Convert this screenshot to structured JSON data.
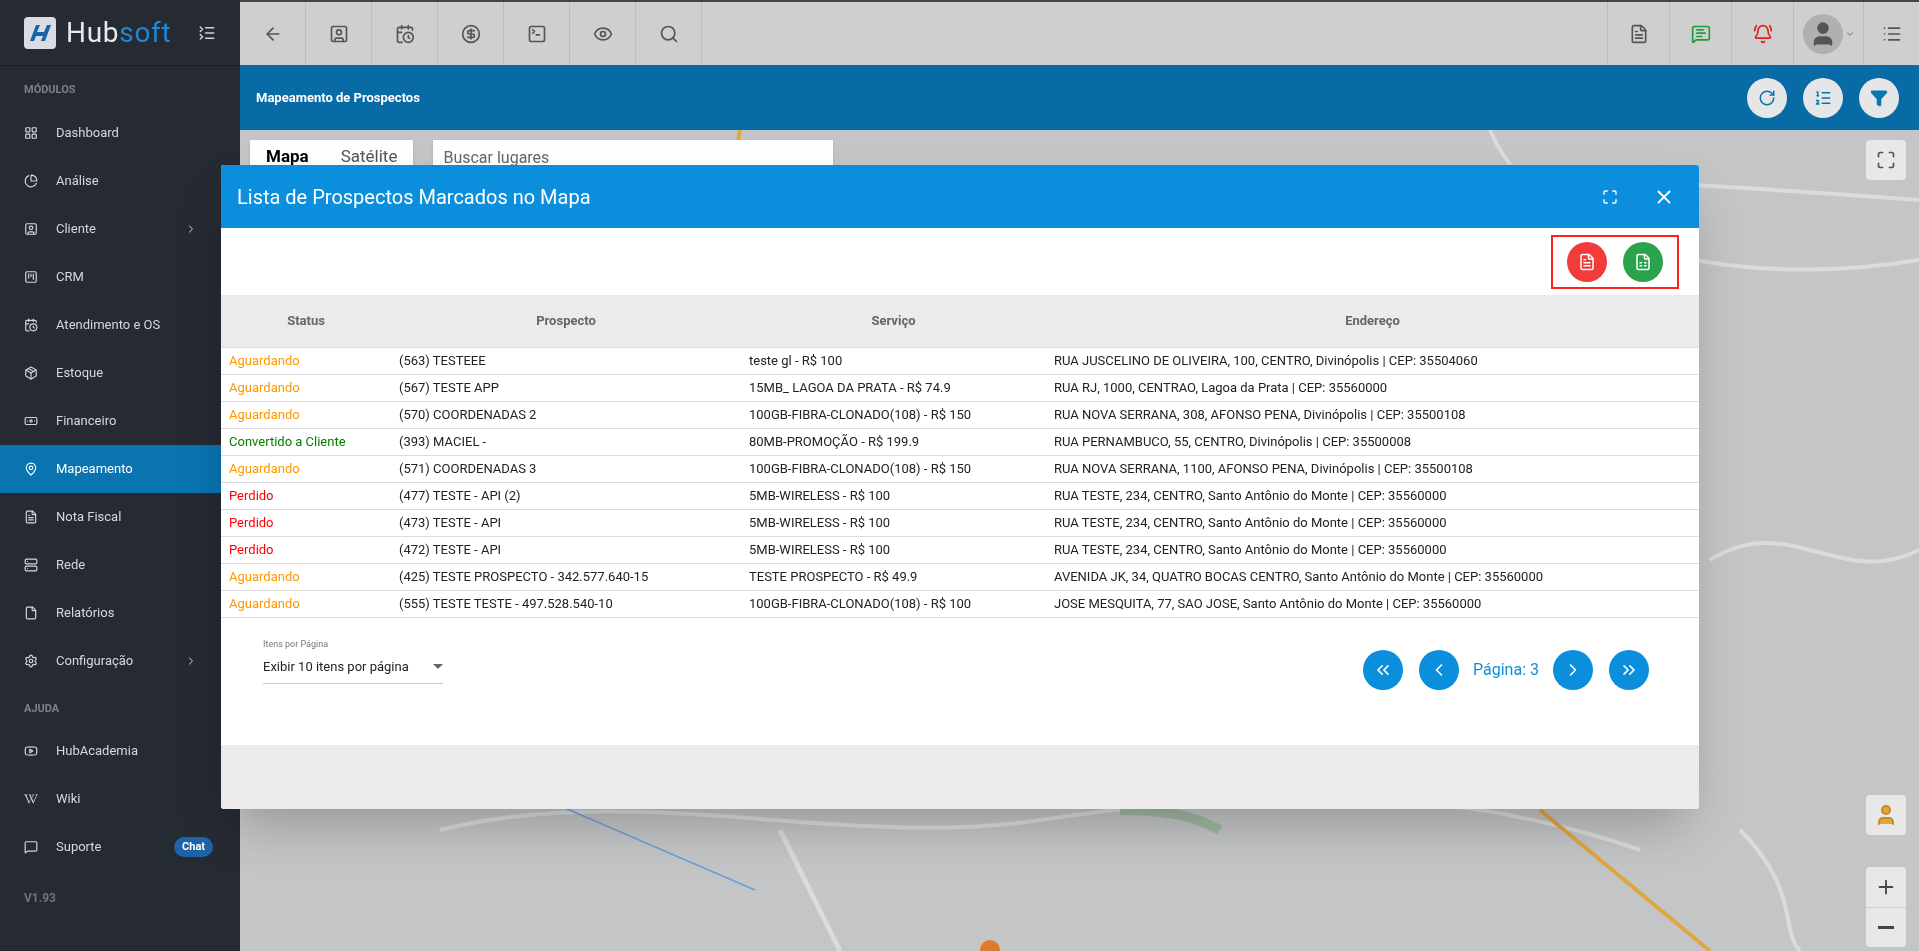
{
  "app": {
    "logo_parts": [
      "Hub",
      "soft"
    ],
    "version": "V1.93"
  },
  "sidebar": {
    "sections": [
      {
        "title": "MÓDULOS",
        "items": [
          {
            "label": "Dashboard",
            "selected": false,
            "has_submenu": false
          },
          {
            "label": "Análise",
            "selected": false,
            "has_submenu": false
          },
          {
            "label": "Cliente",
            "selected": false,
            "has_submenu": true
          },
          {
            "label": "CRM",
            "selected": false,
            "has_submenu": false
          },
          {
            "label": "Atendimento e OS",
            "selected": false,
            "has_submenu": false
          },
          {
            "label": "Estoque",
            "selected": false,
            "has_submenu": false
          },
          {
            "label": "Financeiro",
            "selected": false,
            "has_submenu": false
          },
          {
            "label": "Mapeamento",
            "selected": true,
            "has_submenu": false
          },
          {
            "label": "Nota Fiscal",
            "selected": false,
            "has_submenu": false
          },
          {
            "label": "Rede",
            "selected": false,
            "has_submenu": false
          },
          {
            "label": "Relatórios",
            "selected": false,
            "has_submenu": false
          },
          {
            "label": "Configuração",
            "selected": false,
            "has_submenu": true
          }
        ]
      },
      {
        "title": "AJUDA",
        "items": [
          {
            "label": "HubAcademia",
            "selected": false,
            "has_submenu": false
          },
          {
            "label": "Wiki",
            "selected": false,
            "has_submenu": false
          },
          {
            "label": "Suporte",
            "selected": false,
            "has_submenu": false,
            "badge": "Chat"
          }
        ]
      }
    ]
  },
  "page_header": {
    "title": "Mapeamento de Prospectos"
  },
  "map": {
    "tabs": [
      {
        "label": "Mapa",
        "selected": true
      },
      {
        "label": "Satélite",
        "selected": false
      }
    ],
    "search": {
      "placeholder": "Buscar lugares"
    }
  },
  "modal": {
    "title": "Lista de Prospectos Marcados no Mapa",
    "columns": [
      "Status",
      "Prospecto",
      "Serviço",
      "Endereço"
    ],
    "rows": [
      {
        "status": "Aguardando",
        "color": "#ff9800",
        "prospect": "(563) TESTEEE",
        "service": "teste gl - R$ 100",
        "address": "RUA JUSCELINO DE OLIVEIRA, 100, CENTRO, Divinópolis | CEP: 35504060"
      },
      {
        "status": "Aguardando",
        "color": "#ff9800",
        "prospect": "(567) TESTE APP",
        "service": "15MB_ LAGOA DA PRATA - R$ 74.9",
        "address": "RUA RJ, 1000, CENTRAO, Lagoa da Prata | CEP: 35560000"
      },
      {
        "status": "Aguardando",
        "color": "#ff9800",
        "prospect": "(570) COORDENADAS 2",
        "service": "100GB-FIBRA-CLONADO(108) - R$ 150",
        "address": "RUA NOVA SERRANA, 308, AFONSO PENA, Divinópolis | CEP: 35500108"
      },
      {
        "status": "Convertido a Cliente",
        "color": "#008000",
        "prospect": "(393) MACIEL -",
        "service": "80MB-PROMOÇÃO - R$ 199.9",
        "address": "RUA PERNAMBUCO, 55, CENTRO, Divinópolis | CEP: 35500008"
      },
      {
        "status": "Aguardando",
        "color": "#ff9800",
        "prospect": "(571) COORDENADAS 3",
        "service": "100GB-FIBRA-CLONADO(108) - R$ 150",
        "address": "RUA NOVA SERRANA, 1100, AFONSO PENA, Divinópolis | CEP: 35500108"
      },
      {
        "status": "Perdido",
        "color": "#ff0000",
        "prospect": "(477) TESTE - API (2)",
        "service": "5MB-WIRELESS - R$ 100",
        "address": "RUA TESTE, 234, CENTRO, Santo Antônio do Monte | CEP: 35560000"
      },
      {
        "status": "Perdido",
        "color": "#ff0000",
        "prospect": "(473) TESTE - API",
        "service": "5MB-WIRELESS - R$ 100",
        "address": "RUA TESTE, 234, CENTRO, Santo Antônio do Monte | CEP: 35560000"
      },
      {
        "status": "Perdido",
        "color": "#ff0000",
        "prospect": "(472) TESTE - API",
        "service": "5MB-WIRELESS - R$ 100",
        "address": "RUA TESTE, 234, CENTRO, Santo Antônio do Monte | CEP: 35560000"
      },
      {
        "status": "Aguardando",
        "color": "#ff9800",
        "prospect": "(425) TESTE PROSPECTO - 342.577.640-15",
        "service": "TESTE PROSPECTO - R$ 49.9",
        "address": "AVENIDA JK, 34, QUATRO BOCAS CENTRO, Santo Antônio do Monte | CEP: 35560000"
      },
      {
        "status": "Aguardando",
        "color": "#ff9800",
        "prospect": "(555) TESTE TESTE - 497.528.540-10",
        "service": "100GB-FIBRA-CLONADO(108) - R$ 100",
        "address": "JOSE MESQUITA, 77, SAO JOSE, Santo Antônio do Monte | CEP: 35560000"
      }
    ],
    "page_size": {
      "label": "Itens por Página",
      "value": "Exibir 10 itens por página"
    },
    "page": "Página: 3"
  }
}
